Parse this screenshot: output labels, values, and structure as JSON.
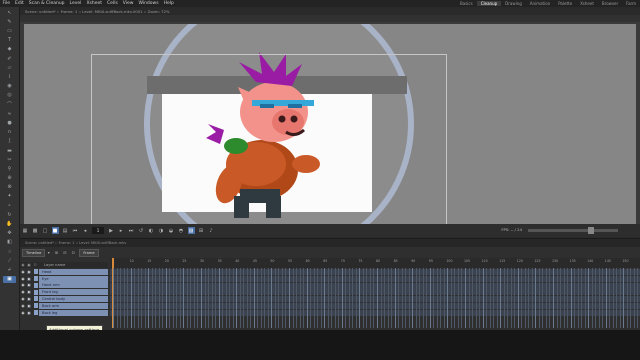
{
  "menubar": {
    "items": [
      "File",
      "Edit",
      "Scan & Cleanup",
      "Level",
      "Xsheet",
      "Cells",
      "View",
      "Windows",
      "Help"
    ]
  },
  "rooms": [
    "Basics",
    "Cleanup",
    "Drawing",
    "Animation",
    "Palette",
    "Xsheet",
    "Browser",
    "Farm"
  ],
  "active_room": "Cleanup",
  "viewer": {
    "title": "Scene: untitled*  ::  Frame: 1  ::  Level: MKIX-sniffBack.mkv.0001  ::  Zoom: 72%",
    "frame_value": "1",
    "fps_label": "FPS: -- / 24"
  },
  "xsheet": {
    "title": "Scene: untitled*  ::  Frame: 1  ::  Level: MKIX-sniffBack.mkv",
    "mode_label": "Timeline",
    "frame_zoom_label": "Frame",
    "layer_header_label": "Layer name",
    "layers": [
      "Head",
      "Eye",
      "Hand arm",
      "Front leg",
      "Central body",
      "Back arm",
      "Back leg"
    ],
    "ruler_ticks": [
      "1",
      "10",
      "15",
      "20",
      "25",
      "30",
      "35",
      "40",
      "45",
      "50",
      "55",
      "60",
      "65",
      "70",
      "75",
      "80",
      "85",
      "90",
      "95",
      "100",
      "105",
      "110",
      "115",
      "120",
      "125",
      "130",
      "135",
      "140",
      "145",
      "150"
    ]
  },
  "tooltip": "Additional column settings",
  "icons": {
    "tools": [
      "selection-tool-icon",
      "brush-tool-icon",
      "geometric-tool-icon",
      "type-tool-icon",
      "fill-tool-icon",
      "paint-brush-tool-icon",
      "eraser-tool-icon",
      "tape-tool-icon",
      "style-picker-icon",
      "rgb-picker-icon",
      "control-point-editor-icon",
      "pinch-tool-icon",
      "pump-tool-icon",
      "magnet-tool-icon",
      "bender-tool-icon",
      "iron-tool-icon",
      "cutter-tool-icon",
      "skeleton-tool-icon",
      "tracker-tool-icon",
      "hook-tool-icon",
      "plastic-tool-icon",
      "zoom-tool-icon",
      "rotate-tool-icon",
      "hand-tool-icon",
      "animate-tool-icon",
      "camera-tool-icon",
      "finger-tool-icon",
      "ruler-tool-icon",
      "type-tool-icon-2",
      "fill-tool-icon-2",
      "eyedropper-tool-icon",
      "paint-tool-icon-2"
    ]
  },
  "colors": {
    "accent": "#4a6fa5",
    "layer_fill": "#7d91b5",
    "canvas_bg": "#868686",
    "pig_pink": "#f3928a",
    "mohawk": "#9a1ca4",
    "glasses": "#35a7d8",
    "shirt": "#c95a28"
  }
}
